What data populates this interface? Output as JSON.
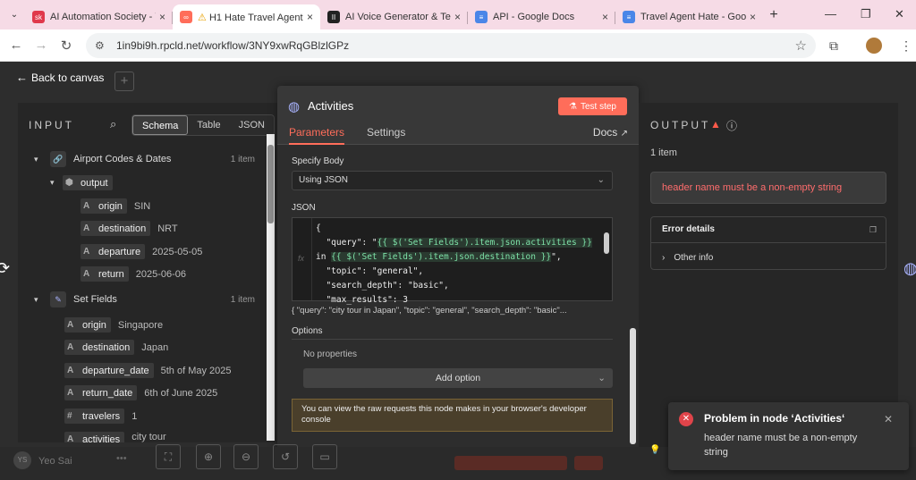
{
  "browser": {
    "tabs": [
      {
        "title": "AI Automation Society - Y",
        "favicon": "sk",
        "color": "#e0384b"
      },
      {
        "title": "H1 Hate Travel Agent",
        "favicon": "n8n",
        "color": "#ff6d5a"
      },
      {
        "title": "AI Voice Generator & Tex",
        "favicon": "II",
        "color": "#222222"
      },
      {
        "title": "API - Google Docs",
        "favicon": "doc",
        "color": "#4a86e8"
      },
      {
        "title": "Travel Agent Hate - Goog",
        "favicon": "doc",
        "color": "#4a86e8"
      }
    ],
    "url": "1in9bi9h.rpcld.net/workflow/3NY9xwRqGBlzlGPz"
  },
  "canvas": {
    "back_label": "Back to canvas"
  },
  "input_panel": {
    "title": "INPUT",
    "views": [
      "Schema",
      "Table",
      "JSON"
    ],
    "active_view": "Schema",
    "nodes": [
      {
        "name": "Airport Codes & Dates",
        "count": "1 item",
        "group": "output",
        "fields": [
          {
            "type": "A",
            "key": "origin",
            "value": "SIN"
          },
          {
            "type": "A",
            "key": "destination",
            "value": "NRT"
          },
          {
            "type": "A",
            "key": "departure",
            "value": "2025-05-05"
          },
          {
            "type": "A",
            "key": "return",
            "value": "2025-06-06"
          }
        ]
      },
      {
        "name": "Set Fields",
        "count": "1 item",
        "fields": [
          {
            "type": "A",
            "key": "origin",
            "value": "Singapore"
          },
          {
            "type": "A",
            "key": "destination",
            "value": "Japan"
          },
          {
            "type": "A",
            "key": "departure_date",
            "value": "5th of May 2025"
          },
          {
            "type": "A",
            "key": "return_date",
            "value": "6th of June 2025"
          },
          {
            "type": "#",
            "key": "travelers",
            "value": "1"
          },
          {
            "type": "A",
            "key": "activities",
            "value": "city tour"
          }
        ]
      }
    ]
  },
  "modal": {
    "title": "Activities",
    "test_step_label": "Test step",
    "tabs": [
      "Parameters",
      "Settings"
    ],
    "docs_label": "Docs",
    "specify_body_label": "Specify Body",
    "specify_body_value": "Using JSON",
    "json_label": "JSON",
    "code_lines": [
      "{",
      "  \"query\": \"{{ $('Set Fields').item.json.activities }}",
      "in {{ $('Set Fields').item.json.destination }}\",",
      "  \"topic\": \"general\",",
      "  \"search_depth\": \"basic\",",
      "  \"max_results\": 3"
    ],
    "preview": "{   \"query\": \"city tour in Japan\",   \"topic\": \"general\",   \"search_depth\": \"basic\"...",
    "options_label": "Options",
    "no_properties": "No properties",
    "add_option_label": "Add option",
    "notice": "You can view the raw requests this node makes in your browser's developer console"
  },
  "output_panel": {
    "title": "OUTPUT",
    "item_count": "1 item",
    "error_message": "header name must be a non-empty string",
    "error_details_label": "Error details",
    "other_info_label": "Other info"
  },
  "user": {
    "initials": "YS",
    "name": "Yeo Sai"
  },
  "toast": {
    "title": "Problem in node ‘Activities‘",
    "message": "header name must be a non-empty string"
  }
}
